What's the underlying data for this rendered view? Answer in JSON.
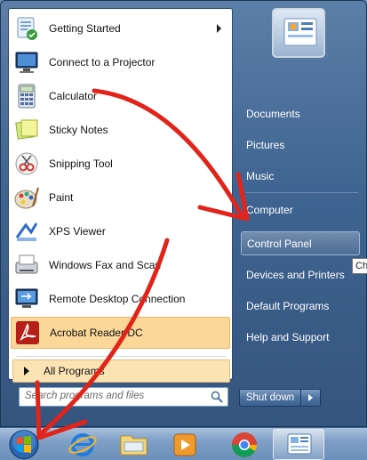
{
  "left_pane": {
    "items": [
      {
        "label": "Getting Started",
        "icon": "getting-started-icon",
        "has_submenu": true
      },
      {
        "label": "Connect to a Projector",
        "icon": "projector-icon"
      },
      {
        "label": "Calculator",
        "icon": "calculator-icon"
      },
      {
        "label": "Sticky Notes",
        "icon": "sticky-notes-icon"
      },
      {
        "label": "Snipping Tool",
        "icon": "snipping-tool-icon"
      },
      {
        "label": "Paint",
        "icon": "paint-icon"
      },
      {
        "label": "XPS Viewer",
        "icon": "xps-viewer-icon"
      },
      {
        "label": "Windows Fax and Scan",
        "icon": "fax-scan-icon"
      },
      {
        "label": "Remote Desktop Connection",
        "icon": "remote-desktop-icon"
      },
      {
        "label": "Acrobat Reader DC",
        "icon": "acrobat-reader-icon"
      }
    ],
    "all_programs": "All Programs",
    "search_placeholder": "Search programs and files"
  },
  "right_pane": {
    "items": [
      {
        "label": "Documents"
      },
      {
        "label": "Pictures"
      },
      {
        "label": "Music"
      },
      {
        "label": "Computer"
      },
      {
        "label": "Control Panel",
        "highlighted": true
      },
      {
        "label": "Devices and Printers"
      },
      {
        "label": "Default Programs"
      },
      {
        "label": "Help and Support"
      }
    ],
    "tooltip_partial": "Ch",
    "shutdown_label": "Shut down"
  },
  "taskbar": {
    "icons": [
      "start-orb-icon",
      "internet-explorer-icon",
      "file-explorer-icon",
      "media-player-icon",
      "chrome-icon",
      "control-panel-icon"
    ]
  },
  "colors": {
    "annotation_red": "#e2231a",
    "highlight_orange": "#fbd89a",
    "menu_blue": "#3f6491"
  }
}
